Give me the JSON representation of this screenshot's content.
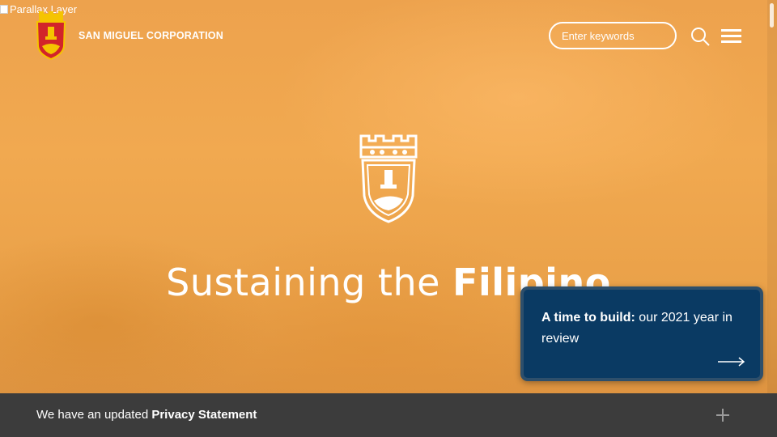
{
  "hero": {
    "alt_text": "Parallax Layer",
    "headline_regular": "Sustaining the ",
    "headline_bold": "Filipino"
  },
  "header": {
    "brand": "SAN MIGUEL CORPORATION",
    "search": {
      "placeholder": "Enter keywords",
      "value": ""
    },
    "search_icon": "search-icon",
    "menu_icon": "hamburger-menu-icon"
  },
  "promo": {
    "bold": "A time to build:",
    "text": " our 2021 year in review",
    "arrow_icon": "arrow-right-icon"
  },
  "privacy": {
    "prefix": "We have an updated ",
    "link": "Privacy Statement",
    "expand_icon": "plus-icon"
  },
  "colors": {
    "hero_orange": "#eda24d",
    "promo_bg": "#0a3a63",
    "privacy_bg": "#3c3c3c",
    "logo_red": "#d2242a",
    "logo_gold": "#f5c400"
  }
}
